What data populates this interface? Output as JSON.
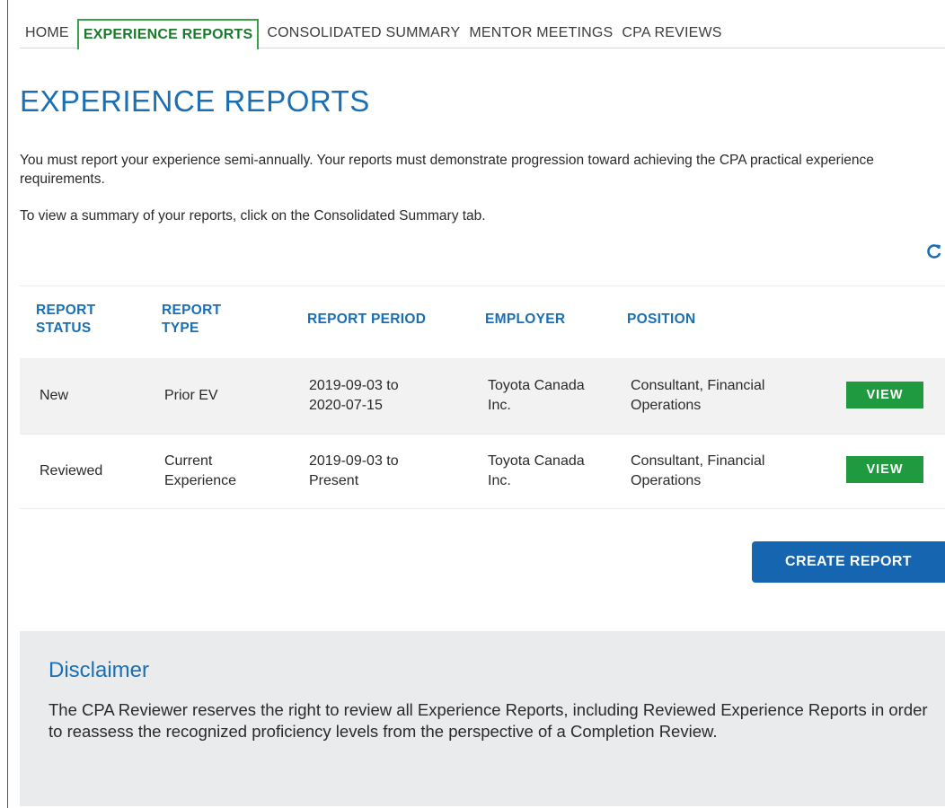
{
  "nav": {
    "items": [
      {
        "label": "HOME",
        "active": false
      },
      {
        "label": "EXPERIENCE REPORTS",
        "active": true
      },
      {
        "label": "CONSOLIDATED SUMMARY",
        "active": false
      },
      {
        "label": "MENTOR MEETINGS",
        "active": false
      },
      {
        "label": "CPA REVIEWS",
        "active": false
      }
    ]
  },
  "page": {
    "title": "EXPERIENCE REPORTS",
    "intro": "You must report your experience semi-annually. Your reports must demonstrate progression toward achieving the CPA practical experience requirements.",
    "intro2": "To view a summary of your reports, click on the Consolidated Summary tab.",
    "refresh_icon": "refresh-icon"
  },
  "table": {
    "headers": {
      "status": "REPORT STATUS",
      "type": "REPORT TYPE",
      "period": "REPORT PERIOD",
      "employer": "EMPLOYER",
      "position": "POSITION"
    },
    "rows": [
      {
        "status": "New",
        "type": "Prior EV",
        "period": "2019-09-03 to 2020-07-15",
        "employer": "Toyota Canada Inc.",
        "position": "Consultant, Financial Operations",
        "action": "VIEW"
      },
      {
        "status": "Reviewed",
        "type": "Current Experience",
        "period": "2019-09-03 to Present",
        "employer": "Toyota Canada Inc.",
        "position": "Consultant, Financial Operations",
        "action": "VIEW"
      }
    ]
  },
  "actions": {
    "create_report": "CREATE REPORT"
  },
  "disclaimer": {
    "title": "Disclaimer",
    "text": "The CPA Reviewer reserves the right to review all Experience Reports, including Reviewed Experience Reports in order to reassess the recognized proficiency levels from the perspective of a Completion Review."
  },
  "colors": {
    "accent_blue": "#1a6fb4",
    "button_green": "#1f9a3f",
    "create_blue": "#1665b0",
    "active_tab_green": "#3aa04a"
  }
}
